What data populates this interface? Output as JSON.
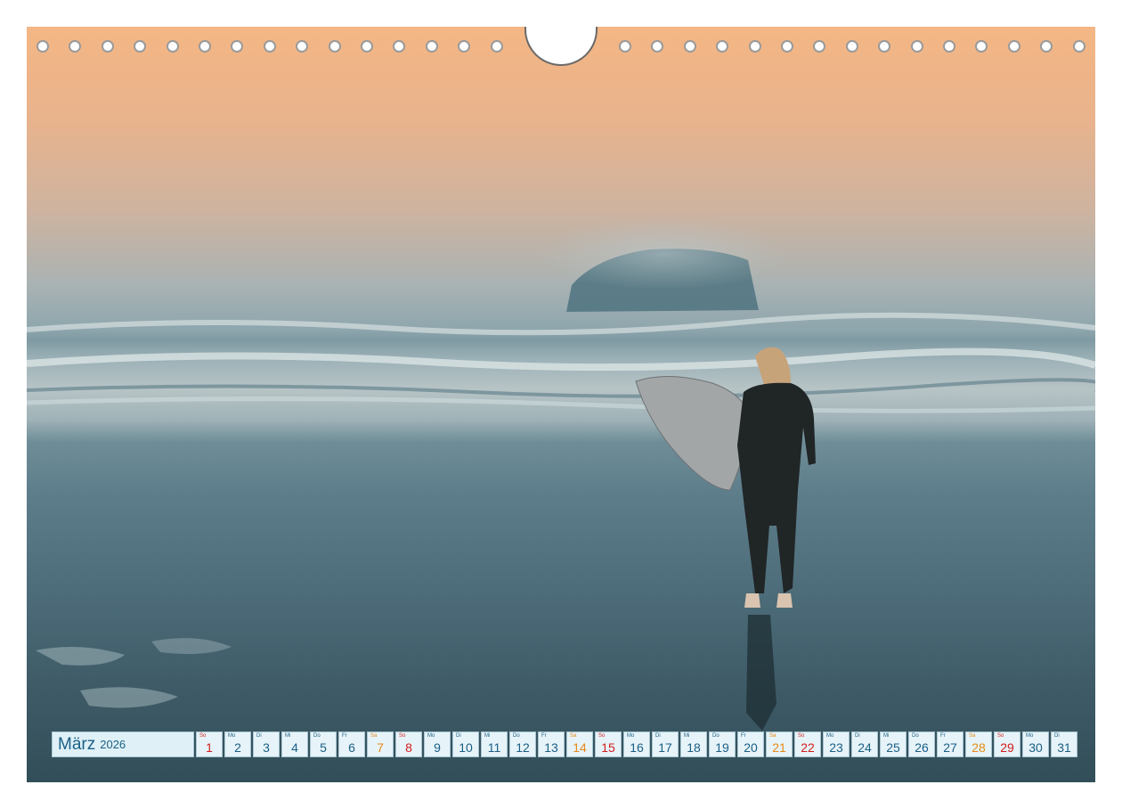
{
  "calendar": {
    "month": "März",
    "year": "2026",
    "days": [
      {
        "dow": "So",
        "num": "1",
        "type": "sun"
      },
      {
        "dow": "Mo",
        "num": "2",
        "type": "wd"
      },
      {
        "dow": "Di",
        "num": "3",
        "type": "wd"
      },
      {
        "dow": "Mi",
        "num": "4",
        "type": "wd"
      },
      {
        "dow": "Do",
        "num": "5",
        "type": "wd"
      },
      {
        "dow": "Fr",
        "num": "6",
        "type": "wd"
      },
      {
        "dow": "Sa",
        "num": "7",
        "type": "sat"
      },
      {
        "dow": "So",
        "num": "8",
        "type": "sun"
      },
      {
        "dow": "Mo",
        "num": "9",
        "type": "wd"
      },
      {
        "dow": "Di",
        "num": "10",
        "type": "wd"
      },
      {
        "dow": "Mi",
        "num": "11",
        "type": "wd"
      },
      {
        "dow": "Do",
        "num": "12",
        "type": "wd"
      },
      {
        "dow": "Fr",
        "num": "13",
        "type": "wd"
      },
      {
        "dow": "Sa",
        "num": "14",
        "type": "sat"
      },
      {
        "dow": "So",
        "num": "15",
        "type": "sun"
      },
      {
        "dow": "Mo",
        "num": "16",
        "type": "wd"
      },
      {
        "dow": "Di",
        "num": "17",
        "type": "wd"
      },
      {
        "dow": "Mi",
        "num": "18",
        "type": "wd"
      },
      {
        "dow": "Do",
        "num": "19",
        "type": "wd"
      },
      {
        "dow": "Fr",
        "num": "20",
        "type": "wd"
      },
      {
        "dow": "Sa",
        "num": "21",
        "type": "sat"
      },
      {
        "dow": "So",
        "num": "22",
        "type": "sun"
      },
      {
        "dow": "Mo",
        "num": "23",
        "type": "wd"
      },
      {
        "dow": "Di",
        "num": "24",
        "type": "wd"
      },
      {
        "dow": "Mi",
        "num": "25",
        "type": "wd"
      },
      {
        "dow": "Do",
        "num": "26",
        "type": "wd"
      },
      {
        "dow": "Fr",
        "num": "27",
        "type": "wd"
      },
      {
        "dow": "Sa",
        "num": "28",
        "type": "sat"
      },
      {
        "dow": "So",
        "num": "29",
        "type": "sun"
      },
      {
        "dow": "Mo",
        "num": "30",
        "type": "wd"
      },
      {
        "dow": "Di",
        "num": "31",
        "type": "wd"
      }
    ]
  },
  "colors": {
    "text": "#1b5f86",
    "sunday": "#d21f1f",
    "saturday": "#e68a19",
    "cell_bg": "#e6f3f8"
  },
  "icons": [
    "binding-hole-icon",
    "hanger-cutout-icon"
  ]
}
